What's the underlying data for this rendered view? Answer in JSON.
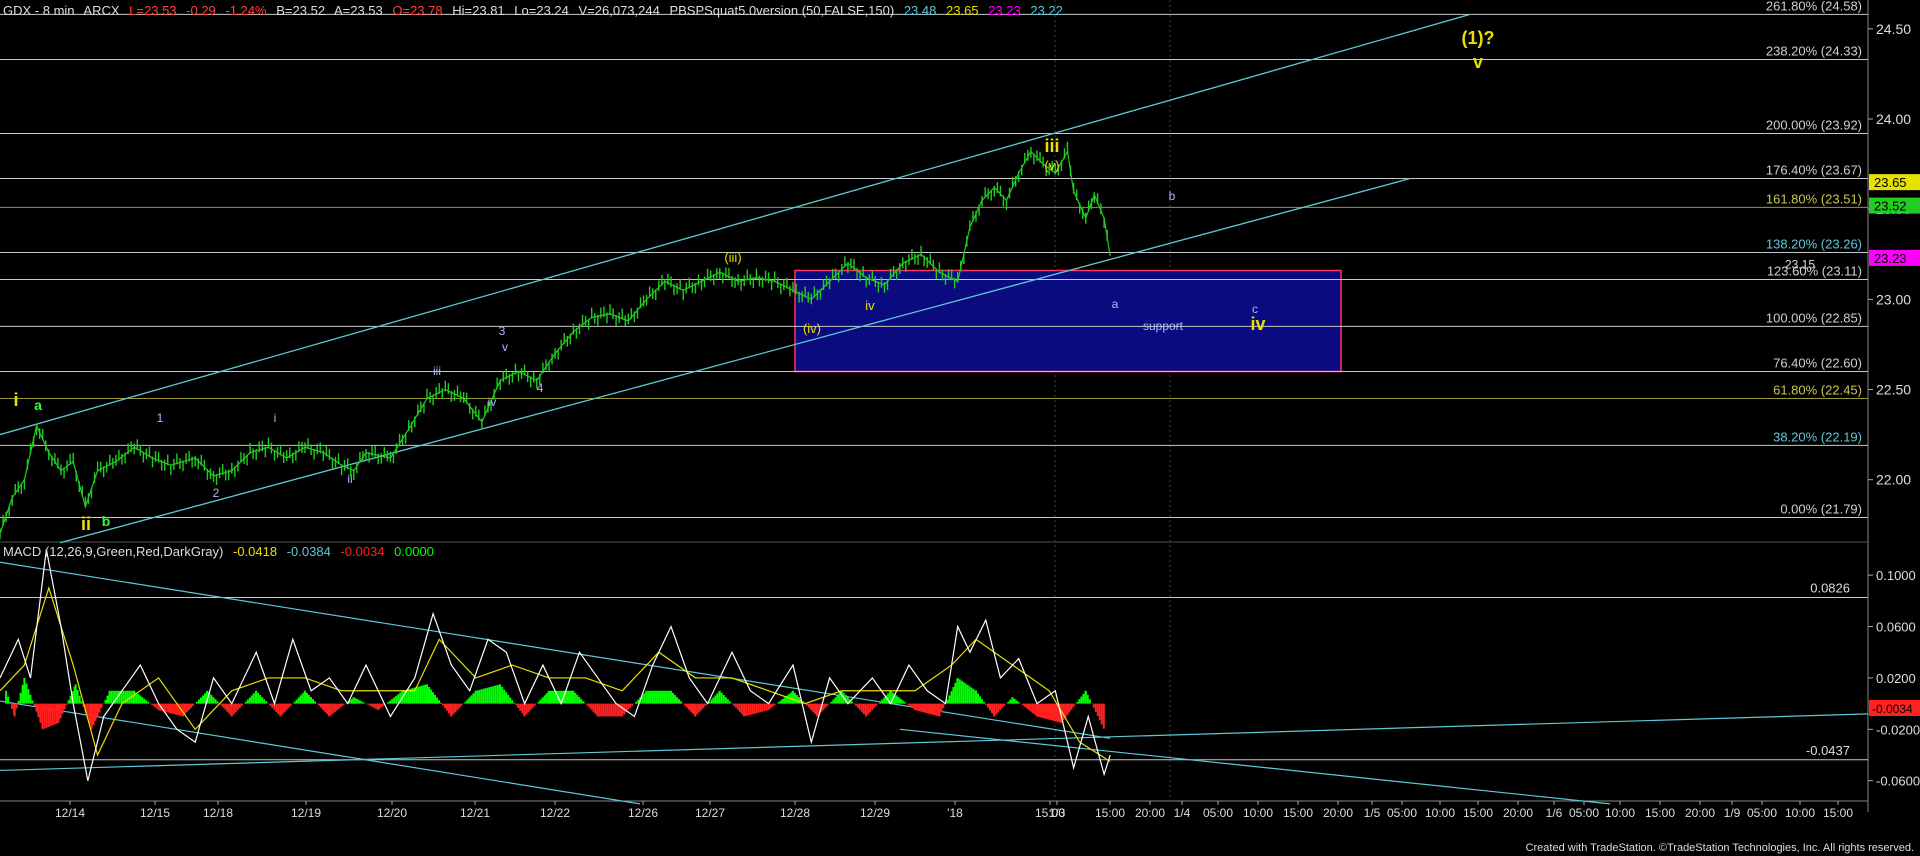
{
  "header": {
    "symbol": "GDX - 8 min",
    "exchange": "ARCX",
    "last": "L=23.53",
    "change": "-0.29",
    "change_pct": "-1.24%",
    "bid": "B=23.52",
    "ask": "A=23.53",
    "open": "O=23.78",
    "high": "Hi=23.81",
    "low": "Lo=23.24",
    "volume": "V=26,073,244",
    "indicator": "PBSPSquat5.0version (50,FALSE,150)",
    "ind_values": [
      "23.48",
      "23.65",
      "23.23",
      "23.22"
    ]
  },
  "macd_header": {
    "label": "MACD (12,26,9,Green,Red,DarkGray)",
    "values": [
      "-0.0418",
      "-0.0384",
      "-0.0034",
      "0.0000"
    ]
  },
  "footer": "Created with TradeStation. ©TradeStation Technologies, Inc. All rights reserved.",
  "colors": {
    "background": "#000000",
    "price_bars": "#22cc22",
    "fib_line": "#c8c8c8",
    "trend_line": "#5fc8d8",
    "support_box_fill": "#0b0b80",
    "support_box_border": "#ff3366",
    "wave_label_yellow": "#e8e000",
    "wave_label_blue": "#b0b8ff",
    "macd_pos": "#00ff00",
    "macd_neg": "#ff2020",
    "macd_line_white": "#ffffff",
    "macd_line_yellow": "#e8e000"
  },
  "chart_data": [
    {
      "type": "line",
      "title": "GDX - 8 min",
      "x_ticks": [
        "12/14",
        "12/15",
        "12/18",
        "12/19",
        "12/20",
        "12/21",
        "12/22",
        "12/26",
        "12/27",
        "12/28",
        "12/29",
        "'18",
        "15:00",
        "1/3",
        "15:00",
        "20:00",
        "1/4",
        "05:00",
        "10:00",
        "15:00",
        "20:00",
        "1/5",
        "05:00",
        "10:00",
        "15:00",
        "20:00",
        "1/6",
        "05:00",
        "10:00",
        "15:00",
        "20:00",
        "1/9",
        "05:00",
        "10:00",
        "15:00"
      ],
      "y_ticks": [
        "24.50",
        "24.00",
        "23.50",
        "23.00",
        "22.50",
        "22.00"
      ],
      "ylim": [
        21.66,
        24.66
      ],
      "close_points": [
        [
          0,
          21.7
        ],
        [
          10,
          21.9
        ],
        [
          20,
          22.0
        ],
        [
          30,
          22.3
        ],
        [
          40,
          22.15
        ],
        [
          50,
          22.05
        ],
        [
          60,
          22.1
        ],
        [
          70,
          21.85
        ],
        [
          80,
          22.05
        ],
        [
          95,
          22.1
        ],
        [
          110,
          22.18
        ],
        [
          125,
          22.12
        ],
        [
          140,
          22.08
        ],
        [
          160,
          22.12
        ],
        [
          175,
          22.02
        ],
        [
          190,
          22.05
        ],
        [
          205,
          22.15
        ],
        [
          220,
          22.18
        ],
        [
          235,
          22.12
        ],
        [
          250,
          22.18
        ],
        [
          265,
          22.15
        ],
        [
          280,
          22.08
        ],
        [
          290,
          22.05
        ],
        [
          300,
          22.15
        ],
        [
          320,
          22.12
        ],
        [
          335,
          22.28
        ],
        [
          350,
          22.45
        ],
        [
          365,
          22.5
        ],
        [
          380,
          22.45
        ],
        [
          395,
          22.32
        ],
        [
          410,
          22.55
        ],
        [
          425,
          22.6
        ],
        [
          440,
          22.55
        ],
        [
          455,
          22.7
        ],
        [
          470,
          22.82
        ],
        [
          485,
          22.9
        ],
        [
          500,
          22.92
        ],
        [
          515,
          22.88
        ],
        [
          530,
          23.0
        ],
        [
          545,
          23.1
        ],
        [
          560,
          23.05
        ],
        [
          575,
          23.1
        ],
        [
          590,
          23.15
        ],
        [
          605,
          23.1
        ],
        [
          620,
          23.12
        ],
        [
          635,
          23.1
        ],
        [
          650,
          23.05
        ],
        [
          665,
          23.0
        ],
        [
          680,
          23.1
        ],
        [
          695,
          23.2
        ],
        [
          710,
          23.12
        ],
        [
          725,
          23.08
        ],
        [
          740,
          23.2
        ],
        [
          755,
          23.25
        ],
        [
          770,
          23.15
        ],
        [
          785,
          23.1
        ],
        [
          795,
          23.4
        ],
        [
          805,
          23.55
        ],
        [
          815,
          23.62
        ],
        [
          825,
          23.55
        ],
        [
          835,
          23.7
        ],
        [
          845,
          23.82
        ],
        [
          855,
          23.75
        ],
        [
          865,
          23.7
        ],
        [
          875,
          23.82
        ],
        [
          880,
          23.6
        ],
        [
          890,
          23.45
        ],
        [
          897,
          23.58
        ],
        [
          905,
          23.45
        ],
        [
          910,
          23.24
        ]
      ],
      "fib_levels": [
        {
          "label": "261.80% (24.58)",
          "value": 24.58
        },
        {
          "label": "238.20% (24.33)",
          "value": 24.33
        },
        {
          "label": "200.00% (23.92)",
          "value": 23.92
        },
        {
          "label": "176.40% (23.67)",
          "value": 23.67
        },
        {
          "label": "161.80% (23.51)",
          "value": 23.51
        },
        {
          "label": "138.20% (23.26)",
          "value": 23.26
        },
        {
          "label": "123.60% (23.11)",
          "value": 23.11
        },
        {
          "label": "100.00% (22.85)",
          "value": 22.85
        },
        {
          "label": "76.40% (22.60)",
          "value": 22.6
        },
        {
          "label": "61.80% (22.45)",
          "value": 22.45
        },
        {
          "label": "38.20% (22.19)",
          "value": 22.19
        },
        {
          "label": "0.00% (21.79)",
          "value": 21.79
        }
      ],
      "price_tags": [
        {
          "text": "23.65",
          "value": 23.65,
          "color": "#e8e000"
        },
        {
          "text": "23.52",
          "value": 23.52,
          "color": "#22cc22"
        },
        {
          "text": "23.23",
          "value": 23.23,
          "color": "#ff00ff"
        }
      ],
      "support_box": {
        "label": "support",
        "top": 23.16,
        "bottom": 22.6
      },
      "line_value_label": "23.15",
      "wave_labels": [
        {
          "text": "(1)?",
          "style": "yellow-large"
        },
        {
          "text": "v",
          "style": "yellow-large"
        },
        {
          "text": "iii",
          "style": "yellow-large"
        },
        {
          "text": "(v)",
          "style": "yellow"
        },
        {
          "text": "(iii)",
          "style": "yellow"
        },
        {
          "text": "(iv)",
          "style": "yellow"
        },
        {
          "text": "iv",
          "style": "yellow-large"
        },
        {
          "text": "c",
          "style": "blue"
        },
        {
          "text": "b",
          "style": "blue"
        },
        {
          "text": "a",
          "style": "blue"
        },
        {
          "text": "i",
          "style": "yellow-large"
        },
        {
          "text": "a",
          "style": "green"
        },
        {
          "text": "ii",
          "style": "yellow-large"
        },
        {
          "text": "b",
          "style": "green"
        },
        {
          "text": "1",
          "style": "blue"
        },
        {
          "text": "2",
          "style": "blue"
        },
        {
          "text": "i",
          "style": "blue"
        },
        {
          "text": "ii",
          "style": "blue"
        },
        {
          "text": "iii",
          "style": "blue"
        },
        {
          "text": "iv",
          "style": "blue"
        },
        {
          "text": "3",
          "style": "blue"
        },
        {
          "text": "v",
          "style": "blue"
        },
        {
          "text": "4",
          "style": "blue"
        },
        {
          "text": "iv",
          "style": "yellow"
        }
      ]
    },
    {
      "type": "line",
      "title": "MACD (12,26,9,Green,Red,DarkGray)",
      "y_ticks": [
        "0.1000",
        "0.0600",
        "0.0200",
        "-0.0200",
        "-0.0600"
      ],
      "ylim": [
        -0.075,
        0.125
      ],
      "level_labels": [
        {
          "text": "0.0826",
          "value": 0.0826
        },
        {
          "text": "-0.0437",
          "value": -0.0437
        }
      ],
      "price_tags": [
        {
          "text": "-0.0034",
          "value": -0.0034,
          "color": "#ff2020"
        }
      ],
      "macd_points": [
        [
          0,
          0.02
        ],
        [
          15,
          0.05
        ],
        [
          25,
          0.02
        ],
        [
          38,
          0.12
        ],
        [
          50,
          0.06
        ],
        [
          60,
          0.0
        ],
        [
          72,
          -0.06
        ],
        [
          85,
          -0.01
        ],
        [
          100,
          0.01
        ],
        [
          115,
          0.03
        ],
        [
          130,
          0.0
        ],
        [
          145,
          -0.02
        ],
        [
          160,
          -0.03
        ],
        [
          175,
          0.02
        ],
        [
          190,
          0.0
        ],
        [
          210,
          0.04
        ],
        [
          225,
          0.0
        ],
        [
          240,
          0.05
        ],
        [
          255,
          0.01
        ],
        [
          270,
          0.02
        ],
        [
          285,
          0.0
        ],
        [
          300,
          0.03
        ],
        [
          320,
          -0.01
        ],
        [
          340,
          0.02
        ],
        [
          355,
          0.07
        ],
        [
          370,
          0.03
        ],
        [
          385,
          0.01
        ],
        [
          400,
          0.05
        ],
        [
          415,
          0.04
        ],
        [
          430,
          0.0
        ],
        [
          445,
          0.03
        ],
        [
          460,
          0.0
        ],
        [
          475,
          0.04
        ],
        [
          490,
          0.02
        ],
        [
          505,
          0.0
        ],
        [
          520,
          -0.01
        ],
        [
          535,
          0.03
        ],
        [
          550,
          0.06
        ],
        [
          565,
          0.02
        ],
        [
          580,
          0.0
        ],
        [
          600,
          0.04
        ],
        [
          615,
          0.01
        ],
        [
          630,
          0.0
        ],
        [
          650,
          0.03
        ],
        [
          665,
          -0.03
        ],
        [
          680,
          0.02
        ],
        [
          695,
          0.0
        ],
        [
          715,
          0.02
        ],
        [
          730,
          0.0
        ],
        [
          745,
          0.03
        ],
        [
          760,
          0.01
        ],
        [
          775,
          0.0
        ],
        [
          785,
          0.06
        ],
        [
          795,
          0.04
        ],
        [
          808,
          0.065
        ],
        [
          820,
          0.02
        ],
        [
          835,
          0.035
        ],
        [
          850,
          0.0
        ],
        [
          865,
          0.01
        ],
        [
          880,
          -0.05
        ],
        [
          892,
          -0.01
        ],
        [
          905,
          -0.055
        ],
        [
          910,
          -0.04
        ]
      ],
      "signal_points": [
        [
          0,
          0.01
        ],
        [
          20,
          0.03
        ],
        [
          40,
          0.09
        ],
        [
          60,
          0.03
        ],
        [
          80,
          -0.04
        ],
        [
          100,
          0.0
        ],
        [
          130,
          0.02
        ],
        [
          160,
          -0.02
        ],
        [
          190,
          0.01
        ],
        [
          220,
          0.02
        ],
        [
          250,
          0.02
        ],
        [
          280,
          0.01
        ],
        [
          310,
          0.01
        ],
        [
          340,
          0.01
        ],
        [
          360,
          0.05
        ],
        [
          390,
          0.02
        ],
        [
          420,
          0.03
        ],
        [
          450,
          0.02
        ],
        [
          480,
          0.02
        ],
        [
          510,
          0.01
        ],
        [
          540,
          0.04
        ],
        [
          570,
          0.02
        ],
        [
          600,
          0.02
        ],
        [
          630,
          0.01
        ],
        [
          660,
          0.0
        ],
        [
          690,
          0.01
        ],
        [
          720,
          0.01
        ],
        [
          750,
          0.01
        ],
        [
          780,
          0.03
        ],
        [
          800,
          0.05
        ],
        [
          830,
          0.03
        ],
        [
          860,
          0.01
        ],
        [
          885,
          -0.03
        ],
        [
          910,
          -0.045
        ]
      ],
      "hist_points": [
        [
          5,
          0.01
        ],
        [
          12,
          -0.01
        ],
        [
          20,
          0.02
        ],
        [
          35,
          -0.02
        ],
        [
          48,
          -0.015
        ],
        [
          62,
          0.015
        ],
        [
          75,
          -0.02
        ],
        [
          90,
          0.01
        ],
        [
          110,
          0.01
        ],
        [
          130,
          -0.005
        ],
        [
          150,
          -0.01
        ],
        [
          170,
          0.01
        ],
        [
          190,
          -0.01
        ],
        [
          210,
          0.01
        ],
        [
          230,
          -0.01
        ],
        [
          250,
          0.01
        ],
        [
          270,
          -0.01
        ],
        [
          290,
          0.005
        ],
        [
          310,
          -0.005
        ],
        [
          330,
          0.01
        ],
        [
          350,
          0.015
        ],
        [
          370,
          -0.01
        ],
        [
          390,
          0.01
        ],
        [
          410,
          0.015
        ],
        [
          430,
          -0.01
        ],
        [
          450,
          0.01
        ],
        [
          470,
          0.01
        ],
        [
          490,
          -0.01
        ],
        [
          510,
          -0.01
        ],
        [
          530,
          0.01
        ],
        [
          550,
          0.01
        ],
        [
          570,
          -0.01
        ],
        [
          590,
          0.01
        ],
        [
          610,
          -0.01
        ],
        [
          630,
          -0.005
        ],
        [
          650,
          0.01
        ],
        [
          670,
          -0.01
        ],
        [
          690,
          0.01
        ],
        [
          710,
          -0.01
        ],
        [
          730,
          0.01
        ],
        [
          750,
          -0.005
        ],
        [
          770,
          -0.01
        ],
        [
          785,
          0.02
        ],
        [
          800,
          0.01
        ],
        [
          815,
          -0.01
        ],
        [
          830,
          0.005
        ],
        [
          850,
          -0.01
        ],
        [
          870,
          -0.015
        ],
        [
          890,
          0.01
        ],
        [
          905,
          -0.02
        ]
      ]
    }
  ]
}
